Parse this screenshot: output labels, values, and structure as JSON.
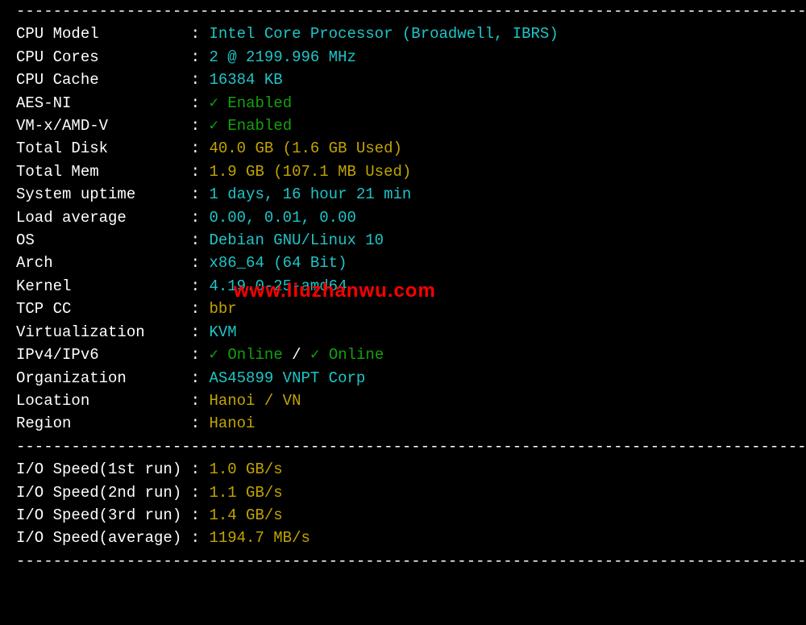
{
  "divider_char": "-",
  "info": {
    "cpu_model": {
      "label": "CPU Model",
      "value": "Intel Core Processor (Broadwell, IBRS)",
      "class": "cyan"
    },
    "cpu_cores": {
      "label": "CPU Cores",
      "value": "2 @ 2199.996 MHz",
      "class": "cyan"
    },
    "cpu_cache": {
      "label": "CPU Cache",
      "value": "16384 KB",
      "class": "cyan"
    },
    "aes_ni": {
      "label": "AES-NI",
      "check": "✓",
      "value": "Enabled",
      "class": "green"
    },
    "vmx": {
      "label": "VM-x/AMD-V",
      "check": "✓",
      "value": "Enabled",
      "class": "green"
    },
    "total_disk": {
      "label": "Total Disk",
      "value": "40.0 GB (1.6 GB Used)",
      "class": "yellow"
    },
    "total_mem": {
      "label": "Total Mem",
      "value": "1.9 GB (107.1 MB Used)",
      "class": "yellow"
    },
    "uptime": {
      "label": "System uptime",
      "value": "1 days, 16 hour 21 min",
      "class": "cyan"
    },
    "load": {
      "label": "Load average",
      "value": "0.00, 0.01, 0.00",
      "class": "cyan"
    },
    "os": {
      "label": "OS",
      "value": "Debian GNU/Linux 10",
      "class": "cyan"
    },
    "arch": {
      "label": "Arch",
      "value": "x86_64 (64 Bit)",
      "class": "cyan"
    },
    "kernel": {
      "label": "Kernel",
      "value": "4.19.0-25-amd64",
      "class": "cyan"
    },
    "tcp_cc": {
      "label": "TCP CC",
      "value": "bbr",
      "class": "yellow"
    },
    "virt": {
      "label": "Virtualization",
      "value": "KVM",
      "class": "cyan"
    },
    "ipvx": {
      "label": "IPv4/IPv6",
      "v4_check": "✓",
      "v4": "Online",
      "sep": "/",
      "v6_check": "✓",
      "v6": "Online"
    },
    "org": {
      "label": "Organization",
      "value": "AS45899 VNPT Corp",
      "class": "cyan"
    },
    "loc": {
      "label": "Location",
      "value": "Hanoi / VN",
      "class": "yellow"
    },
    "region": {
      "label": "Region",
      "value": "Hanoi",
      "class": "yellow"
    }
  },
  "io": {
    "r1": {
      "label": "I/O Speed(1st run)",
      "value": "1.0 GB/s"
    },
    "r2": {
      "label": "I/O Speed(2nd run)",
      "value": "1.1 GB/s"
    },
    "r3": {
      "label": "I/O Speed(3rd run)",
      "value": "1.4 GB/s"
    },
    "avg": {
      "label": "I/O Speed(average)",
      "value": "1194.7 MB/s"
    }
  },
  "watermark": "www.liuzhanwu.com"
}
